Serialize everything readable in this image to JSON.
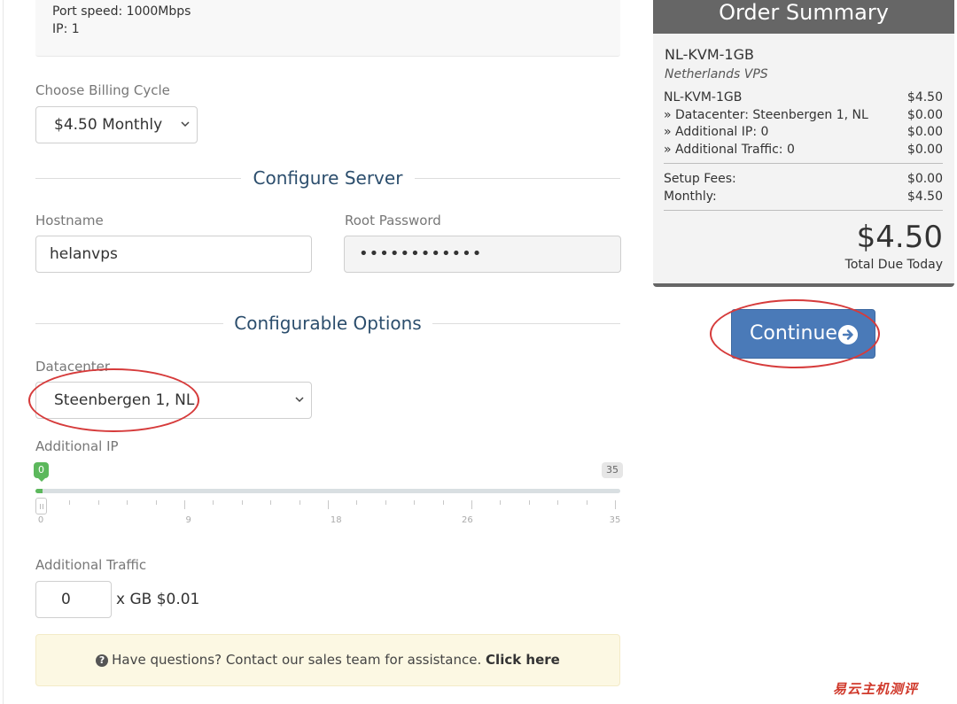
{
  "product_info": {
    "port_speed": "Port speed: 1000Mbps",
    "ip": "IP: 1"
  },
  "billing": {
    "label": "Choose Billing Cycle",
    "selected": "$4.50 Monthly"
  },
  "configure_server": {
    "title": "Configure Server",
    "hostname_label": "Hostname",
    "hostname_value": "helanvps",
    "root_password_label": "Root Password",
    "root_password_value": "••••••••••••"
  },
  "configurable_options": {
    "title": "Configurable Options",
    "datacenter_label": "Datacenter",
    "datacenter_selected": "Steenbergen 1, NL",
    "additional_ip_label": "Additional IP",
    "slider": {
      "min": 0,
      "max": 35,
      "value": 0,
      "min_label": "0",
      "max_label": "35",
      "tick_labels": [
        "0",
        "9",
        "18",
        "26",
        "35"
      ]
    },
    "additional_traffic_label": "Additional Traffic",
    "traffic_value": "0",
    "traffic_suffix": "x GB $0.01"
  },
  "help": {
    "icon": "question-circle-icon",
    "text": "Have questions? Contact our sales team for assistance.",
    "link": "Click here"
  },
  "order_summary": {
    "title": "Order Summary",
    "product_name": "NL-KVM-1GB",
    "product_group": "Netherlands VPS",
    "lines": [
      {
        "label": "NL-KVM-1GB",
        "amount": "$4.50"
      },
      {
        "label": "» Datacenter: Steenbergen 1, NL",
        "amount": "$0.00"
      },
      {
        "label": "» Additional IP: 0",
        "amount": "$0.00"
      },
      {
        "label": "» Additional Traffic: 0",
        "amount": "$0.00"
      }
    ],
    "setup_fees_label": "Setup Fees:",
    "setup_fees": "$0.00",
    "monthly_label": "Monthly:",
    "monthly": "$4.50",
    "total": "$4.50",
    "total_label": "Total Due Today"
  },
  "continue_button": {
    "label": "Continue",
    "icon": "arrow-circle-right-icon"
  },
  "watermark": "易云主机测评",
  "colors": {
    "accent": "#4a7ab8",
    "heading": "#2c4e6d",
    "slider_fill": "#5cb85c",
    "summary_header": "#666666",
    "annotation": "#d63b3b"
  }
}
